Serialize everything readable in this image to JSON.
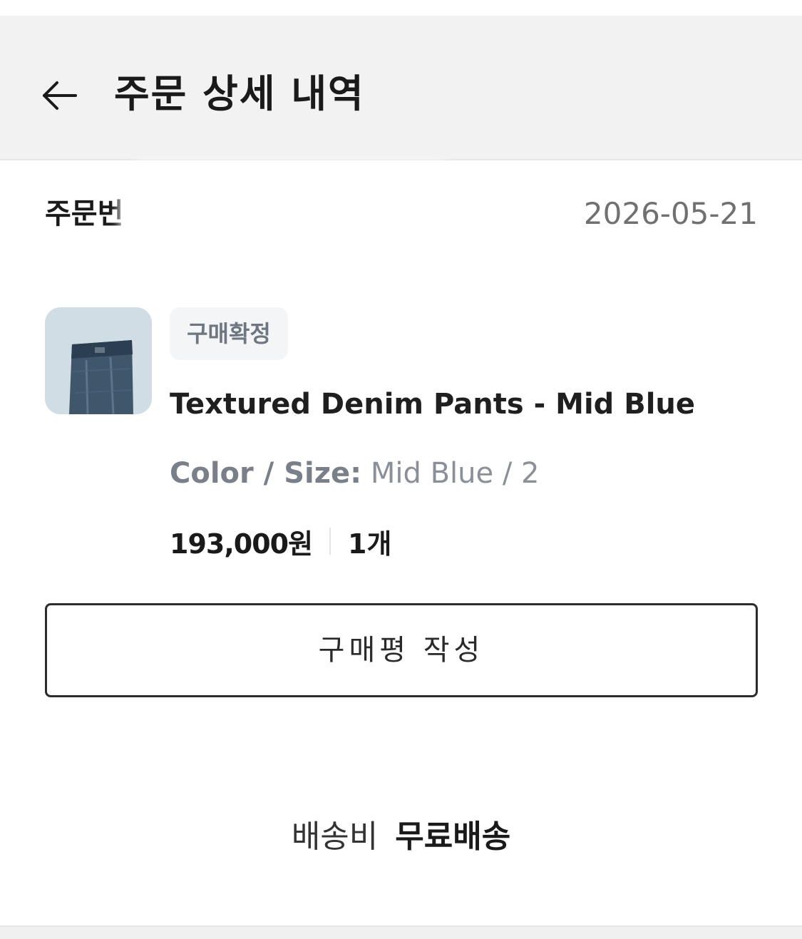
{
  "header": {
    "title": "주문 상세 내역",
    "back_icon": "arrow-left-icon"
  },
  "order": {
    "number_label": "주문번",
    "number_value": "",
    "date": "2026-05-21"
  },
  "item": {
    "status": "구매확정",
    "name": "Textured Denim Pants - Mid Blue",
    "option_label": "Color / Size:",
    "option_value": "Mid Blue / 2",
    "price": "193,000원",
    "quantity": "1개",
    "review_button_label": "구매평 작성"
  },
  "shipping": {
    "label": "배송비",
    "value": "무료배송"
  },
  "colors": {
    "header_bg": "#f2f2f2",
    "badge_bg": "#f3f5f7",
    "badge_text": "#6e7681",
    "muted_text": "#8a8f98",
    "button_border": "#2c2c2c"
  }
}
